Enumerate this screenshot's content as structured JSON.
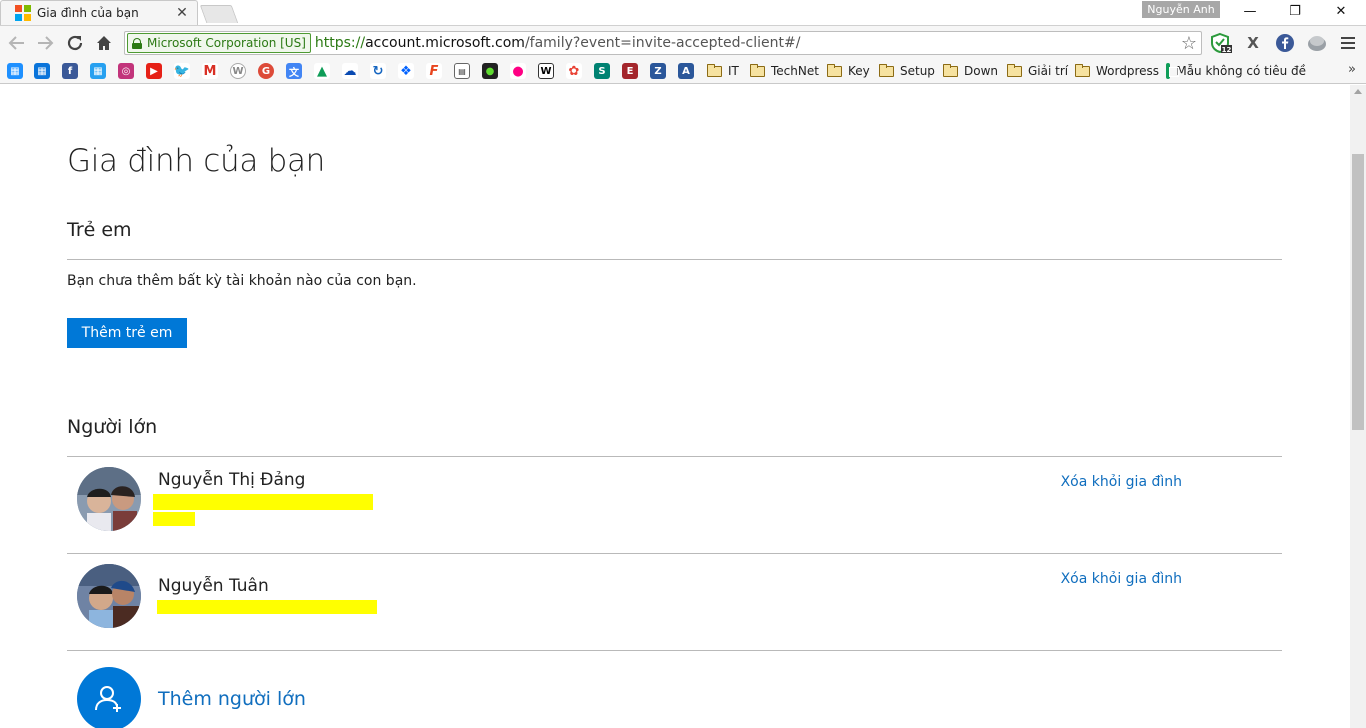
{
  "browser": {
    "tab_title": "Gia đình của bạn",
    "tab_close": "✕",
    "profile_name": "Nguyễn Anh",
    "window_controls": {
      "minimize": "—",
      "restore": "❐",
      "close": "✕"
    },
    "ev_label": "Microsoft Corporation [US]",
    "url": {
      "scheme": "https://",
      "host": "account.microsoft.com",
      "path": "/family?event=invite-accepted-client#/"
    },
    "extension_badge": "12",
    "bookmark_folders": [
      "IT",
      "TechNet",
      "Key",
      "Setup",
      "Down",
      "Giải trí",
      "Wordpress"
    ],
    "bookmark_sheet": "Mẫu không có tiêu đề",
    "bookmark_overflow": "»",
    "icons": [
      "back-icon",
      "forward-icon",
      "reload-icon",
      "home-icon",
      "star-icon",
      "menu-icon"
    ]
  },
  "page": {
    "title": "Gia đình của bạn",
    "children_section": {
      "heading": "Trẻ em",
      "empty_text": "Bạn chưa thêm bất kỳ tài khoản nào của con bạn.",
      "add_button": "Thêm trẻ em"
    },
    "adults_section": {
      "heading": "Người lớn",
      "members": [
        {
          "name": "Nguyễn Thị Đảng",
          "remove_label": "Xóa khỏi gia đình"
        },
        {
          "name": "Nguyễn Tuân",
          "remove_label": "Xóa khỏi gia đình"
        }
      ],
      "add_label": "Thêm người lớn"
    }
  },
  "colors": {
    "accent": "#0078d7",
    "link": "#106ebe",
    "redaction": "#ffff00"
  }
}
